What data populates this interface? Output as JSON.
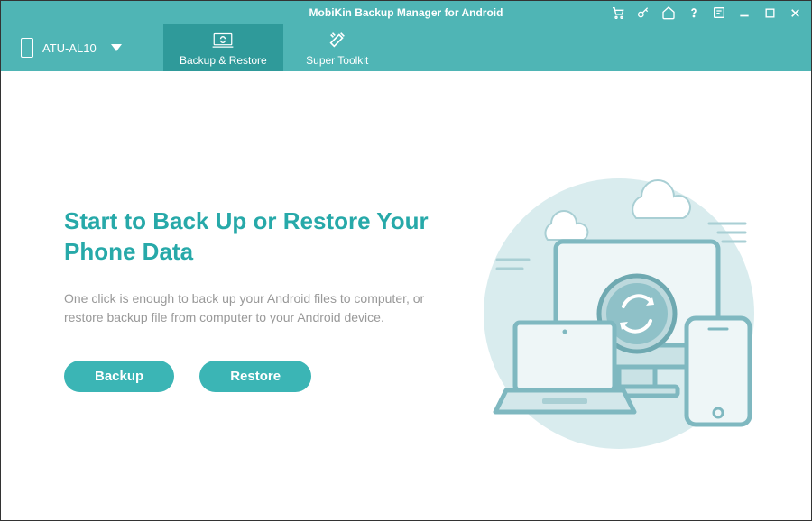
{
  "titlebar": {
    "title": "MobiKin Backup Manager for Android"
  },
  "device": {
    "name": "ATU-AL10"
  },
  "tabs": {
    "backup_restore": "Backup & Restore",
    "super_toolkit": "Super Toolkit"
  },
  "main": {
    "headline": "Start to Back Up or Restore Your Phone Data",
    "subtext": "One click is enough to back up your Android files to computer, or restore backup file from computer to your Android device.",
    "backup_btn": "Backup",
    "restore_btn": "Restore"
  }
}
